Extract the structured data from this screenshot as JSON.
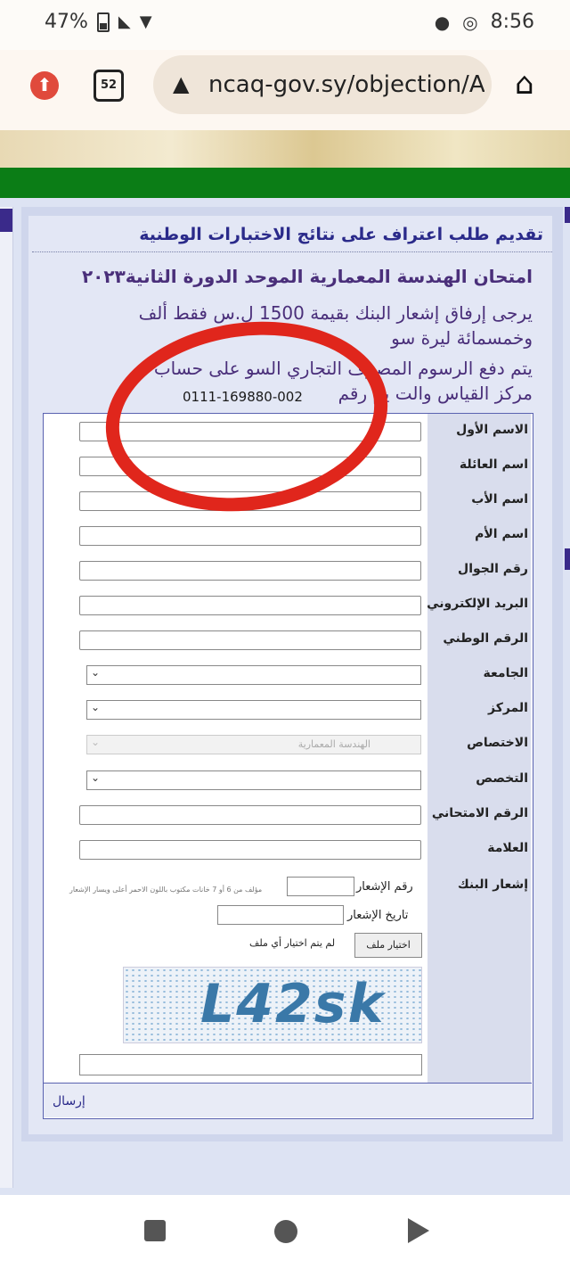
{
  "status_bar": {
    "battery": "47%",
    "time": "8:56"
  },
  "browser": {
    "tab_count": "52",
    "url": "ncaq-gov.sy/objection/A"
  },
  "page": {
    "title": "تقديم طلب اعتراف على نتائج الاختبارات الوطنية",
    "exam_title": "امتحان الهندسة المعمارية الموحد الدورة الثانية٢٠٢٣",
    "instruction_1": "يرجى إرفاق إشعار البنك بقيمة 1500 ل.س فقط ألف",
    "instruction_2": "وخمسمائة ليرة سو",
    "instruction_3": "يتم دفع الرسوم  المصرف التجاري السو  على حساب",
    "instruction_4": "مركز القياس والت   يم رقم",
    "account_number": "0111-169880-002"
  },
  "form": {
    "fields": [
      {
        "label": "الاسم الأول",
        "value": ""
      },
      {
        "label": "اسم العائلة",
        "value": ""
      },
      {
        "label": "اسم الأب",
        "value": ""
      },
      {
        "label": "اسم الأم",
        "value": ""
      },
      {
        "label": "رقم الجوال",
        "value": ""
      },
      {
        "label": "البريد الإلكتروني",
        "value": ""
      },
      {
        "label": "الرقم الوطني",
        "value": ""
      }
    ],
    "university_label": "الجامعة",
    "center_label": "المركز",
    "specialization_label": "الاختصاص",
    "specialization_value": "الهندسة المعمارية",
    "subspecialty_label": "التخصص",
    "exam_number_label": "الرقم الامتحاني",
    "grade_label": "العلامة",
    "bank_notice_label": "إشعار البنك",
    "notice_number_label": "رقم الإشعار",
    "notice_hint": "مؤلف من 6 أو 7 خانات مكتوب باللون الاحمر أعلى ويسار الإشعار",
    "notice_date_label": "تاريخ الإشعار",
    "file_button": "اختيار ملف",
    "file_status": "لم يتم اختيار أي ملف",
    "captcha_text": "L42sk",
    "submit_label": "إرسال"
  }
}
